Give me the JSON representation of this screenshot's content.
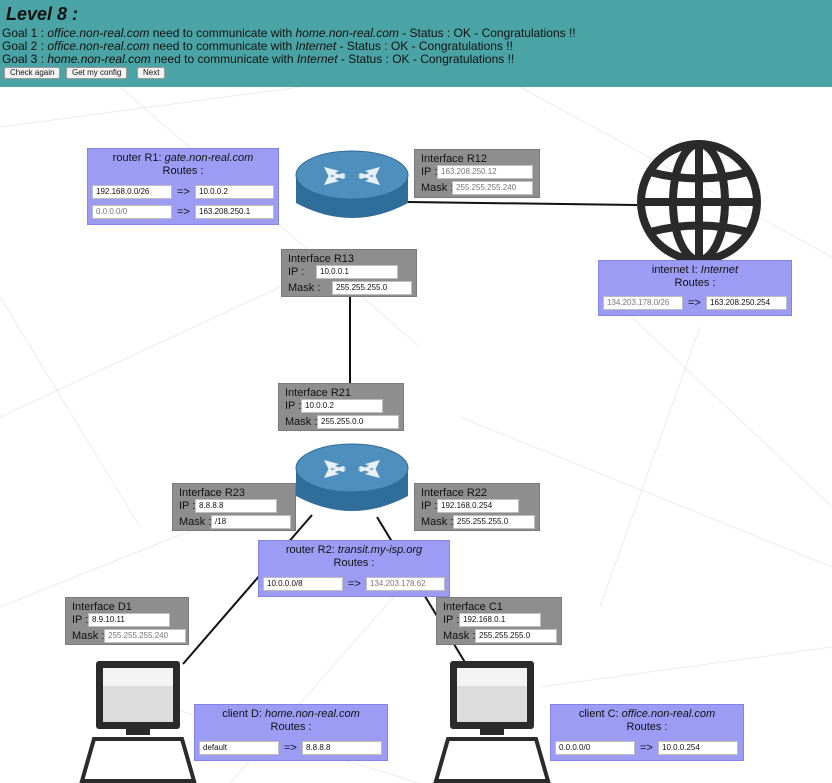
{
  "header": {
    "level": "Level 8 :",
    "goals": [
      {
        "prefix": "Goal 1 : ",
        "src": "office.non-real.com",
        "mid": " need to communicate with ",
        "dst": "home.non-real.com",
        "status": " - Status : OK - Congratulations !!"
      },
      {
        "prefix": "Goal 2 : ",
        "src": "office.non-real.com",
        "mid": " need to communicate with ",
        "dst": "Internet",
        "status": " - Status : OK - Congratulations !!"
      },
      {
        "prefix": "Goal 3 : ",
        "src": "home.non-real.com",
        "mid": " need to communicate with ",
        "dst": "Internet",
        "status": " - Status : OK - Congratulations !!"
      }
    ],
    "buttons": {
      "check": "Check again",
      "config": "Get my config",
      "next": "Next"
    }
  },
  "routers": {
    "r1": {
      "title_prefix": "router R1: ",
      "host": "gate.non-real.com",
      "routes_label": "Routes :",
      "routes": [
        {
          "dest": "192.168.0.0/26",
          "arrow": "=>",
          "via": "10.0.0.2"
        },
        {
          "dest": "0.0.0.0/0",
          "arrow": "=>",
          "via": "163.208.250.1"
        }
      ]
    },
    "r2": {
      "title_prefix": "router R2: ",
      "host": "transit.my-isp.org",
      "routes_label": "Routes :",
      "routes": [
        {
          "dest": "10.0.0.0/8",
          "arrow": "=>",
          "via": "134.203.178.62"
        }
      ]
    }
  },
  "internet": {
    "title_prefix": "internet I: ",
    "host": "Internet",
    "routes_label": "Routes :",
    "routes": [
      {
        "dest": "134.203.178.0/26",
        "arrow": "=>",
        "via": "163.208.250.254"
      }
    ]
  },
  "clients": {
    "d": {
      "title_prefix": "client D: ",
      "host": "home.non-real.com",
      "routes_label": "Routes :",
      "routes": [
        {
          "dest": "default",
          "arrow": "=>",
          "via": "8.8.8.8"
        }
      ]
    },
    "c": {
      "title_prefix": "client C: ",
      "host": "office.non-real.com",
      "routes_label": "Routes :",
      "routes": [
        {
          "dest": "0.0.0.0/0",
          "arrow": "=>",
          "via": "10.0.0.254"
        }
      ]
    }
  },
  "labels": {
    "ip": "IP :",
    "mask": "Mask :"
  },
  "interfaces": {
    "r12": {
      "name": "Interface R12",
      "ip": "163.208.250.12",
      "mask": "255.255.255.240"
    },
    "r13": {
      "name": "Interface R13",
      "ip": "10.0.0.1",
      "mask": "255.255.255.0"
    },
    "r21": {
      "name": "Interface R21",
      "ip": "10.0.0.2",
      "mask": "255.255.0.0"
    },
    "r22": {
      "name": "Interface R22",
      "ip": "192.168.0.254",
      "mask": "255.255.255.0"
    },
    "r23": {
      "name": "Interface R23",
      "ip": "8.8.8.8",
      "mask": "/18"
    },
    "d1": {
      "name": "Interface D1",
      "ip": "8.9.10.11",
      "mask": "255.255.255.240"
    },
    "c1": {
      "name": "Interface C1",
      "ip": "192.168.0.1",
      "mask": "255.255.255.0"
    }
  },
  "colors": {
    "header": "#4aa3a4",
    "router_box": "#9c9cf5",
    "interface_box": "#8e8e8e",
    "router_body": "#3f7fae"
  },
  "icons": {
    "router": "router-icon",
    "globe": "globe-icon",
    "computer": "computer-icon"
  }
}
